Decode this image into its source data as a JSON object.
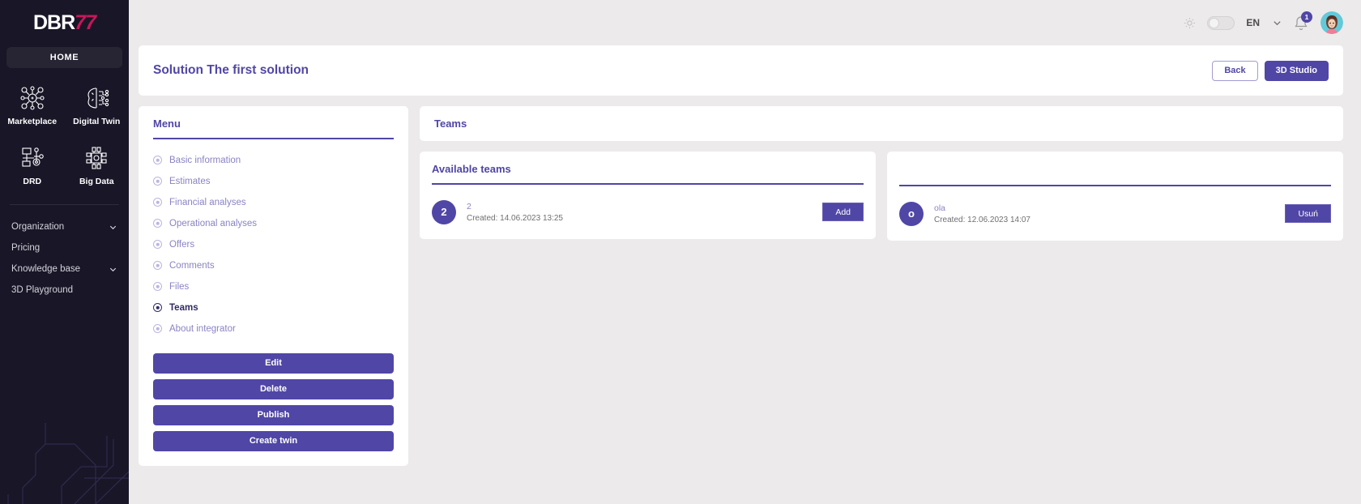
{
  "sidebar": {
    "logo": {
      "part1": "DBR",
      "part2": "77"
    },
    "home_label": "HOME",
    "tiles": [
      {
        "label": "Marketplace",
        "icon": "marketplace-icon"
      },
      {
        "label": "Digital Twin",
        "icon": "digital-twin-icon"
      },
      {
        "label": "DRD",
        "icon": "drd-icon"
      },
      {
        "label": "Big Data",
        "icon": "big-data-icon"
      }
    ],
    "links": [
      {
        "label": "Organization",
        "chevron": true
      },
      {
        "label": "Pricing",
        "chevron": false
      },
      {
        "label": "Knowledge base",
        "chevron": true
      },
      {
        "label": "3D Playground",
        "chevron": false
      }
    ]
  },
  "topbar": {
    "theme_icon": "sun-icon",
    "language": "EN",
    "notification_count": "1",
    "avatar": "user-avatar"
  },
  "header": {
    "title": "Solution The first solution",
    "back_label": "Back",
    "studio_label": "3D Studio"
  },
  "menu": {
    "title": "Menu",
    "items": [
      {
        "label": "Basic information",
        "active": false
      },
      {
        "label": "Estimates",
        "active": false
      },
      {
        "label": "Financial analyses",
        "active": false
      },
      {
        "label": "Operational analyses",
        "active": false
      },
      {
        "label": "Offers",
        "active": false
      },
      {
        "label": "Comments",
        "active": false
      },
      {
        "label": "Files",
        "active": false
      },
      {
        "label": "Teams",
        "active": true
      },
      {
        "label": "About integrator",
        "active": false
      }
    ],
    "actions": [
      {
        "label": "Edit"
      },
      {
        "label": "Delete"
      },
      {
        "label": "Publish"
      },
      {
        "label": "Create twin"
      }
    ]
  },
  "teams": {
    "title": "Teams",
    "available": {
      "title": "Available teams",
      "rows": [
        {
          "avatar": "2",
          "name": "2",
          "date": "Created: 14.06.2023 13:25",
          "button": "Add"
        }
      ]
    },
    "assigned": {
      "title": "",
      "rows": [
        {
          "avatar": "o",
          "name": "ola",
          "date": "Created: 12.06.2023 14:07",
          "button": "Usuń"
        }
      ]
    }
  },
  "colors": {
    "accent": "#5046a6",
    "accent_light": "#8a83c4",
    "sidebar_bg": "#191627",
    "page_bg": "#eceaea",
    "logo_accent": "#c8175a"
  }
}
